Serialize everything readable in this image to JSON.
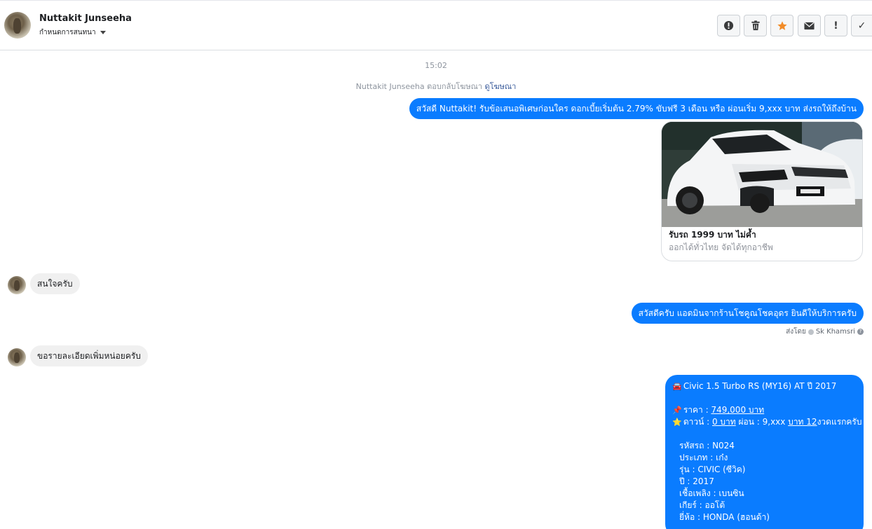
{
  "header": {
    "name": "Nuttakit Junseeha",
    "subtitle": "กำหนดการสนทนา"
  },
  "toolbar": {
    "buttons": [
      {
        "icon": "alert-circle-icon",
        "glyph": "!"
      },
      {
        "icon": "trash-icon"
      },
      {
        "icon": "star-icon",
        "color": "#f28c28"
      },
      {
        "icon": "envelope-icon"
      },
      {
        "icon": "exclamation-icon",
        "glyph": "!"
      },
      {
        "icon": "check-icon",
        "glyph": "✓"
      }
    ]
  },
  "conversation": {
    "timestamp": "15:02",
    "ad_reply_prefix": "Nuttakit Junseeha ตอบกลับโฆษณา",
    "ad_reply_link": "ดูโฆษณา",
    "messages": [
      {
        "dir": "out",
        "text": "สวัสดี Nuttakit! รับข้อเสนอพิเศษก่อนใคร ดอกเบี้ยเริ่มต้น 2.79%  ขับฟรี 3 เดือน หรือ ผ่อนเริ่ม 9,xxx บาท ส่งรถให้ถึงบ้าน"
      },
      {
        "dir": "in",
        "text": "สนใจครับ"
      },
      {
        "dir": "out",
        "text": "สวัสดีครับ แอดมินจากร้านโชคูณโชคอุดร ยินดีให้บริการครับ"
      },
      {
        "dir": "in",
        "text": "ขอรายละเอียดเพิ่มหน่อยครับ"
      }
    ],
    "ad_card": {
      "title": "รับรถ 1999 บาท ไม่ค้ำ",
      "subtitle": "ออกได้ทั่วไทย จัดได้ทุกอาชีพ"
    },
    "sent_by": {
      "prefix": "ส่งโดย",
      "name": "Sk Khamsri"
    },
    "detail": {
      "title": "Civic 1.5 Turbo RS (MY16) AT ปี 2017",
      "price_label": "ราคา : ",
      "price_value": "749,000 บาท",
      "down_label": "ดาวน์ : ",
      "down_value": "0 บาท",
      "installment_label": " ผ่อน :  9,xxx ",
      "installment_unit": "บาท 12",
      "installment_suffix": "งวดแรกครับ",
      "specs": [
        "รหัสรถ : N024",
        "ประเภท : เก๋ง",
        "รุ่น : CIVIC (ซีวิค)",
        "ปี : 2017",
        "เชื้อเพลิง : เบนซิน",
        "เกียร์ : ออโต้",
        "ยี่ห้อ : HONDA (ฮอนด้า)"
      ]
    }
  },
  "colors": {
    "outgoing": "#0a7cff",
    "incoming": "#f0f0f0",
    "star": "#f28c28"
  }
}
